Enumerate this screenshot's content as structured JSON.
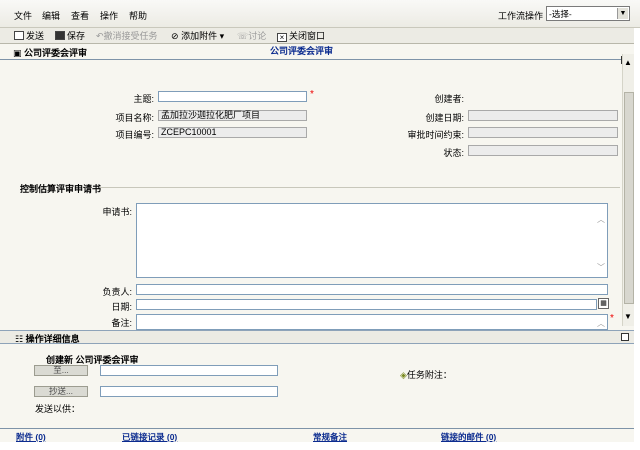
{
  "menubar": {
    "items": [
      "文件",
      "编辑",
      "查看",
      "操作",
      "帮助"
    ],
    "workflow_label": "工作流操作",
    "workflow_select_value": "-选择-"
  },
  "toolbar": {
    "send": "发送",
    "save": "保存",
    "cancel_accept": "撤消接受任务",
    "add_attachment": "添加附件",
    "discuss": "讨论",
    "close_window": "关闭窗口"
  },
  "form": {
    "tab_label": "公司评委会评审",
    "title": "公司评委会评审",
    "fields_left": {
      "subject_label": "主题:",
      "subject_value": "",
      "project_name_label": "项目名称:",
      "project_name_value": "孟加拉沙迦拉化肥厂项目",
      "project_code_label": "项目编号:",
      "project_code_value": "ZCEPC10001"
    },
    "fields_right": {
      "creator_label": "创建者:",
      "created_date_label": "创建日期:",
      "approval_deadline_label": "审批时间约束:",
      "status_label": "状态:"
    },
    "section": {
      "title": "控制估算评审申请书",
      "application_label": "申请书:",
      "owner_label": "负责人:",
      "date_label": "日期:",
      "remark_label": "备注:"
    }
  },
  "detail": {
    "header": "操作详细信息",
    "create_new": "创建新 公司评委会评审",
    "to_button": "至...",
    "cc_button": "抄送...",
    "send_for_label": "发送以供：",
    "task_note_label": "任务附注："
  },
  "bottom": {
    "attachments": "附件 (0)",
    "linked_records": "已链接记录 (0)",
    "regular_notes": "常规备注",
    "linked_mail": "链接的邮件 (0)"
  }
}
